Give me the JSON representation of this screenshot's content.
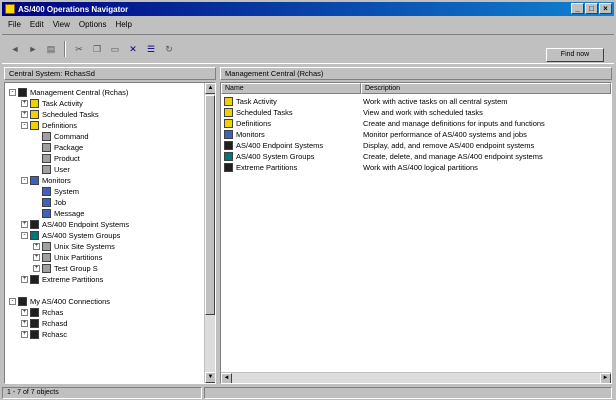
{
  "window": {
    "title": "AS/400 Operations Navigator",
    "buttons": [
      "_",
      "□",
      "×"
    ]
  },
  "menu": [
    "File",
    "Edit",
    "View",
    "Options",
    "Help"
  ],
  "toolbar": {
    "find_button": "Find now"
  },
  "left_pane": {
    "title": "Central System: RchasSd",
    "tree": [
      {
        "label": "Management Central (Rchas)",
        "expander": "-",
        "indent": 0,
        "icon": "dark"
      },
      {
        "label": "Task Activity",
        "expander": "+",
        "indent": 1,
        "icon": "yellow"
      },
      {
        "label": "Scheduled Tasks",
        "expander": "+",
        "indent": 1,
        "icon": "yellow"
      },
      {
        "label": "Definitions",
        "expander": "-",
        "indent": 1,
        "icon": "yellow"
      },
      {
        "label": "Command",
        "expander": "",
        "indent": 2,
        "icon": "gray"
      },
      {
        "label": "Package",
        "expander": "",
        "indent": 2,
        "icon": "gray"
      },
      {
        "label": "Product",
        "expander": "",
        "indent": 2,
        "icon": "gray"
      },
      {
        "label": "User",
        "expander": "",
        "indent": 2,
        "icon": "gray"
      },
      {
        "label": "Monitors",
        "expander": "-",
        "indent": 1,
        "icon": "blue"
      },
      {
        "label": "System",
        "expander": "",
        "indent": 2,
        "icon": "blue"
      },
      {
        "label": "Job",
        "expander": "",
        "indent": 2,
        "icon": "blue"
      },
      {
        "label": "Message",
        "expander": "",
        "indent": 2,
        "icon": "blue"
      },
      {
        "label": "AS/400 Endpoint Systems",
        "expander": "+",
        "indent": 1,
        "icon": "dark"
      },
      {
        "label": "AS/400 System Groups",
        "expander": "-",
        "indent": 1,
        "icon": "teal"
      },
      {
        "label": "Unix Site Systems",
        "expander": "+",
        "indent": 2,
        "icon": "gray"
      },
      {
        "label": "Unix Partitions",
        "expander": "+",
        "indent": 2,
        "icon": "gray"
      },
      {
        "label": "Test Group S",
        "expander": "+",
        "indent": 2,
        "icon": "gray"
      },
      {
        "label": "Extreme Partitions",
        "expander": "+",
        "indent": 1,
        "icon": "dark"
      },
      {
        "label": "",
        "expander": "",
        "indent": 0,
        "icon": ""
      },
      {
        "label": "My AS/400 Connections",
        "expander": "-",
        "indent": 0,
        "icon": "dark"
      },
      {
        "label": "Rchas",
        "expander": "+",
        "indent": 1,
        "icon": "dark"
      },
      {
        "label": "Rchasd",
        "expander": "+",
        "indent": 1,
        "icon": "dark"
      },
      {
        "label": "Rchasc",
        "expander": "+",
        "indent": 1,
        "icon": "dark"
      }
    ]
  },
  "right_pane": {
    "title": "Management Central (Rchas)",
    "columns": [
      "Name",
      "Description"
    ],
    "rows": [
      {
        "name": "Task Activity",
        "desc": "Work with active tasks on all central system",
        "icon": "yellow"
      },
      {
        "name": "Scheduled Tasks",
        "desc": "View and work with scheduled tasks",
        "icon": "yellow"
      },
      {
        "name": "Definitions",
        "desc": "Create and manage definitions for inputs and functions",
        "icon": "yellow"
      },
      {
        "name": "Monitors",
        "desc": "Monitor performance of AS/400 systems and jobs",
        "icon": "blue"
      },
      {
        "name": "AS/400 Endpoint Systems",
        "desc": "Display, add, and remove AS/400 endpoint systems",
        "icon": "dark"
      },
      {
        "name": "AS/400 System Groups",
        "desc": "Create, delete, and manage AS/400 endpoint systems",
        "icon": "teal"
      },
      {
        "name": "Extreme Partitions",
        "desc": "Work with AS/400 logical partitions",
        "icon": "dark"
      }
    ]
  },
  "status": {
    "text": "1 - 7 of 7 objects"
  }
}
